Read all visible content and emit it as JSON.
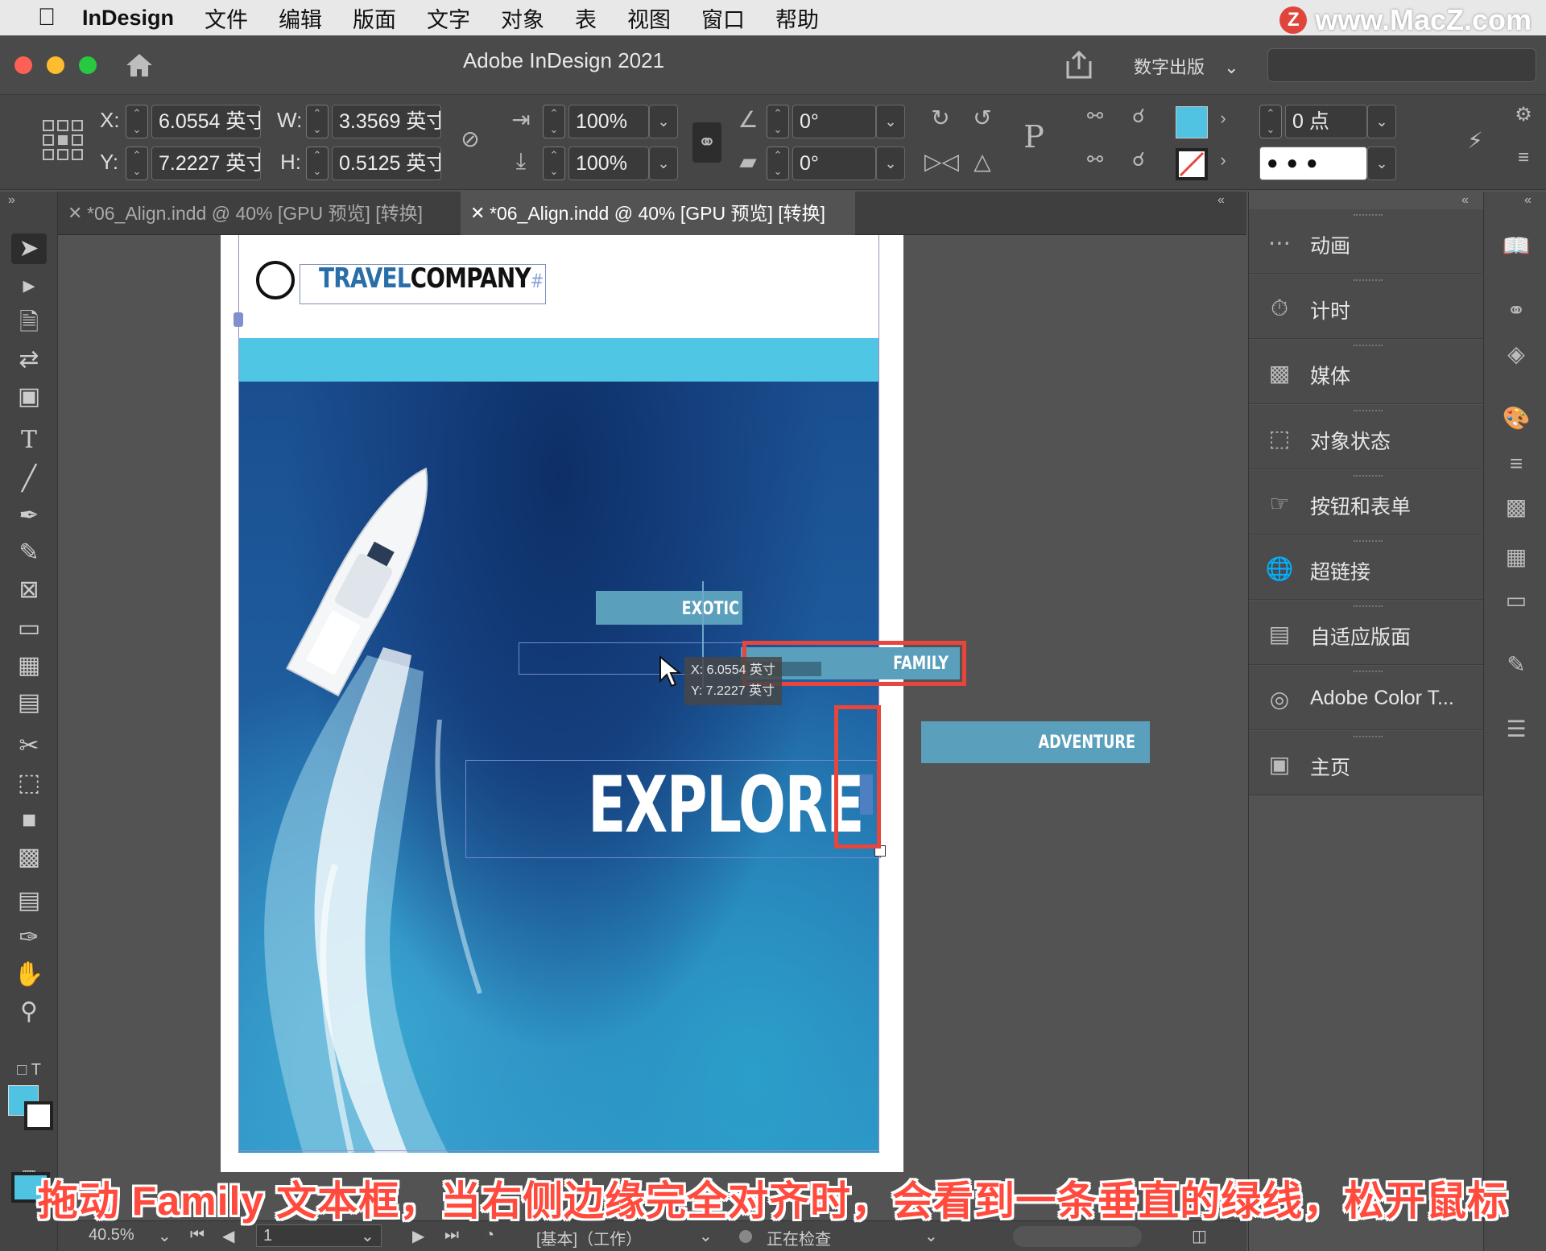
{
  "menubar": {
    "app_name": "InDesign",
    "items": [
      "文件",
      "编辑",
      "版面",
      "文字",
      "对象",
      "表",
      "视图",
      "窗口",
      "帮助"
    ],
    "watermark_text": "www.MacZ.com",
    "watermark_logo": "Z"
  },
  "titlebar": {
    "title": "Adobe InDesign 2021",
    "workspace": "数字出版"
  },
  "control_panel": {
    "x_label": "X:",
    "x_value": "6.0554 英寸",
    "y_label": "Y:",
    "y_value": "7.2227 英寸",
    "w_label": "W:",
    "w_value": "3.3569 英寸",
    "h_label": "H:",
    "h_value": "0.5125 英寸",
    "scale_x": "100%",
    "scale_y": "100%",
    "rotate": "0°",
    "shear": "0°",
    "stroke_weight": "0 点",
    "fill_color": "#4fc3e1"
  },
  "tabs": [
    {
      "label": "*06_Align.indd @ 40% [GPU 预览] [转换]",
      "active": false
    },
    {
      "label": "*06_Align.indd @ 40% [GPU 预览] [转换]",
      "active": true
    }
  ],
  "document": {
    "logo_word1": "TRAVEL",
    "logo_word2": "COMPANY",
    "logo_hash": "#",
    "buttons": [
      "EXOTIC",
      "FAMILY",
      "ADVENTURE"
    ],
    "headline": "EXPLORE",
    "tooltip_x": "X: 6.0554 英寸",
    "tooltip_y": "Y: 7.2227 英寸"
  },
  "statusbar": {
    "zoom": "40.5%",
    "page": "1",
    "profile": "[基本]（工作）",
    "preflight": "正在检查"
  },
  "panels": [
    {
      "label": "动画",
      "icon": "animation-icon"
    },
    {
      "label": "计时",
      "icon": "timing-icon"
    },
    {
      "label": "媒体",
      "icon": "media-icon"
    },
    {
      "label": "对象状态",
      "icon": "object-states-icon"
    },
    {
      "label": "按钮和表单",
      "icon": "buttons-forms-icon"
    },
    {
      "label": "超链接",
      "icon": "hyperlinks-icon"
    },
    {
      "label": "自适应版面",
      "icon": "liquid-layout-icon"
    },
    {
      "label": "Adobe Color T...",
      "icon": "adobe-color-icon"
    },
    {
      "label": "主页",
      "icon": "pages-icon"
    }
  ],
  "caption": "拖动 Family 文本框，当右侧边缘完全对齐时，会看到一条垂直的绿线，松开鼠标",
  "colors": {
    "accent_red": "#e8453c",
    "cyan": "#4ec6e4",
    "button_band": "#5a9fbc"
  }
}
